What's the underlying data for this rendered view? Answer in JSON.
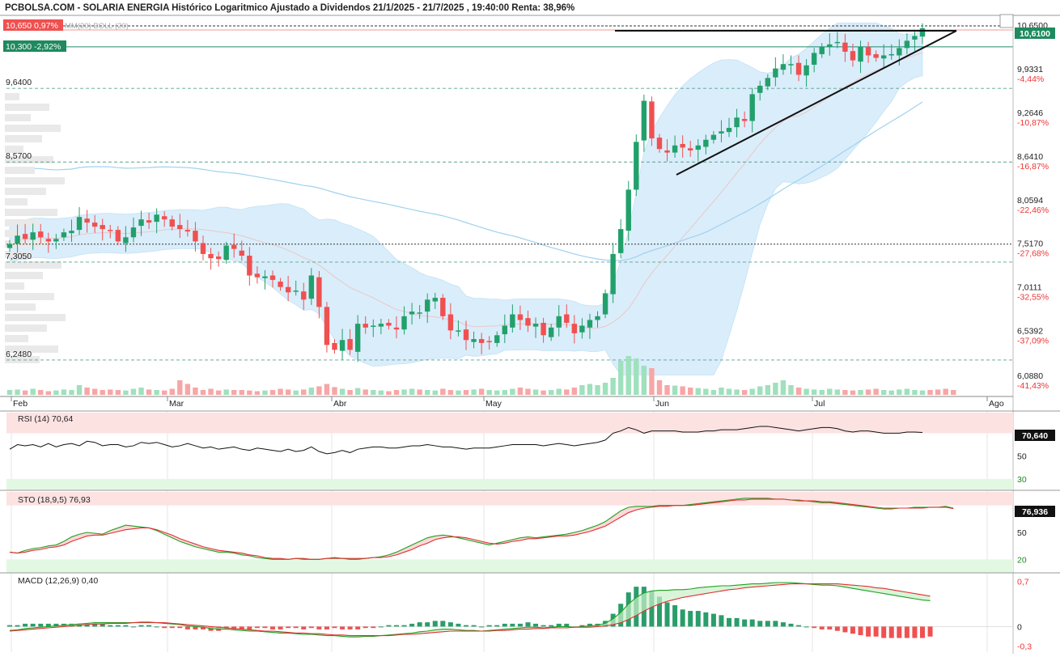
{
  "header": {
    "title": "PCBOLSA.COM - SOLARIA ENERGIA Histórico Logaritmico Ajustado a Dividendos 21/1/2025 - 21/7/2025 , 19:40:00 Renta: 38,96%",
    "boll_label": "MM(20) BOLL (20)"
  },
  "badges": {
    "high_label": "10,650  0,97%",
    "low_label": "10,300  -2,92%",
    "last_price": "10,6100"
  },
  "colors": {
    "up": "#22a06b",
    "down": "#f05050",
    "boll_fill": "#d6ecfb",
    "mm50": "#9fd2f0",
    "rsi_line": "#111111",
    "sto_k": "#22a022",
    "sto_d": "#e03030",
    "macd_line": "#22a022",
    "signal_line": "#e03030",
    "overbought_band": "#fde2e2",
    "oversold_band": "#e3f8e3"
  },
  "chart_data": [
    {
      "type": "candlestick",
      "title": "SOLARIA ENERGIA",
      "scale": "log",
      "x_ticks": [
        "Feb",
        "Mar",
        "Abr",
        "May",
        "Jun",
        "Jul",
        "Ago"
      ],
      "y_ticks": [
        {
          "value": 10.65,
          "label": "10,6500",
          "pct": ""
        },
        {
          "value": 9.9331,
          "label": "9,9331",
          "pct": "-4,44%"
        },
        {
          "value": 9.2646,
          "label": "9,2646",
          "pct": "-10,87%"
        },
        {
          "value": 8.641,
          "label": "8,6410",
          "pct": "-16,87%"
        },
        {
          "value": 8.0594,
          "label": "8,0594",
          "pct": "-22,46%"
        },
        {
          "value": 7.517,
          "label": "7,5170",
          "pct": "-27,68%"
        },
        {
          "value": 7.0111,
          "label": "7,0111",
          "pct": "-32,55%"
        },
        {
          "value": 6.5392,
          "label": "6,5392",
          "pct": "-37,09%"
        },
        {
          "value": 6.088,
          "label": "6,0880",
          "pct": "-41,43%"
        }
      ],
      "levels": [
        {
          "value": 9.64,
          "label": "9,6400"
        },
        {
          "value": 8.57,
          "label": "8,5700"
        },
        {
          "value": 7.305,
          "label": "7,3050"
        },
        {
          "value": 6.248,
          "label": "6,2480"
        },
        {
          "value": 10.3,
          "label": ""
        },
        {
          "value": 10.65,
          "label": ""
        },
        {
          "value": 7.517,
          "label": ""
        }
      ],
      "close": [
        7.52,
        7.62,
        7.58,
        7.66,
        7.6,
        7.55,
        7.58,
        7.66,
        7.68,
        7.85,
        7.78,
        7.73,
        7.7,
        7.68,
        7.55,
        7.6,
        7.72,
        7.82,
        7.78,
        7.88,
        7.82,
        7.73,
        7.7,
        7.67,
        7.55,
        7.4,
        7.35,
        7.34,
        7.5,
        7.46,
        7.38,
        7.15,
        7.13,
        7.14,
        7.1,
        7.02,
        6.96,
        6.98,
        6.88,
        7.15,
        6.8,
        6.4,
        6.35,
        6.45,
        6.35,
        6.62,
        6.58,
        6.6,
        6.62,
        6.6,
        6.56,
        6.7,
        6.75,
        6.74,
        6.88,
        6.9,
        6.7,
        6.55,
        6.55,
        6.45,
        6.46,
        6.42,
        6.43,
        6.5,
        6.6,
        6.72,
        6.66,
        6.6,
        6.62,
        6.5,
        6.58,
        6.7,
        6.63,
        6.52,
        6.6,
        6.66,
        6.7,
        6.95,
        7.4,
        7.7,
        8.2,
        8.85,
        9.45,
        8.9,
        8.75,
        8.7,
        8.8,
        8.77,
        8.73,
        8.8,
        8.88,
        8.95,
        9.0,
        9.05,
        9.2,
        9.15,
        9.55,
        9.68,
        9.8,
        9.95,
        10.02,
        10.02,
        9.85,
        10.0,
        10.2,
        10.3,
        10.34,
        10.38,
        10.22,
        10.08,
        10.3,
        10.16,
        10.12,
        10.16,
        10.18,
        10.28,
        10.4,
        10.48,
        10.61
      ],
      "volume_scale_note": "relative",
      "volume": [
        20,
        22,
        18,
        25,
        20,
        15,
        18,
        22,
        20,
        40,
        30,
        25,
        20,
        22,
        20,
        18,
        25,
        30,
        22,
        20,
        18,
        25,
        60,
        45,
        30,
        20,
        25,
        18,
        22,
        20,
        20,
        18,
        15,
        18,
        20,
        25,
        22,
        18,
        22,
        30,
        35,
        45,
        32,
        25,
        20,
        28,
        22,
        20,
        18,
        15,
        20,
        22,
        25,
        22,
        20,
        18,
        25,
        20,
        18,
        20,
        22,
        25,
        20,
        18,
        20,
        25,
        30,
        25,
        22,
        18,
        20,
        25,
        22,
        30,
        40,
        45,
        40,
        50,
        70,
        140,
        160,
        150,
        120,
        110,
        60,
        40,
        38,
        35,
        30,
        28,
        25,
        20,
        30,
        25,
        22,
        20,
        25,
        35,
        40,
        50,
        60,
        40,
        30,
        25,
        22,
        20,
        25,
        22,
        20,
        18,
        20,
        22,
        25,
        20,
        18,
        22,
        25,
        20,
        18,
        20,
        22,
        25,
        20
      ],
      "volume_up_note": "bars coloured green when close rises, red when it falls"
    },
    {
      "type": "line",
      "title": "RSI (14)",
      "last_value": "70,64",
      "last_badge": "70,640",
      "y_ticks": [
        "50",
        "30"
      ],
      "overbought": 70,
      "oversold": 30,
      "values": [
        56,
        60,
        59,
        60,
        58,
        61,
        58,
        60,
        61,
        59,
        63,
        62,
        59,
        60,
        60,
        58,
        59,
        62,
        61,
        62,
        60,
        58,
        59,
        61,
        59,
        57,
        58,
        56,
        57,
        58,
        56,
        55,
        57,
        56,
        55,
        54,
        56,
        54,
        55,
        58,
        54,
        52,
        53,
        55,
        53,
        56,
        57,
        58,
        58,
        57,
        57,
        58,
        59,
        59,
        60,
        59,
        58,
        58,
        57,
        56,
        57,
        57,
        57,
        58,
        59,
        60,
        60,
        60,
        60,
        59,
        60,
        61,
        60,
        59,
        60,
        61,
        62,
        64,
        70,
        72,
        75,
        73,
        70,
        72,
        72,
        72,
        72,
        71,
        71,
        71,
        72,
        72,
        73,
        73,
        73,
        74,
        75,
        76,
        76,
        75,
        74,
        73,
        72,
        73,
        74,
        75,
        75,
        74,
        72,
        71,
        72,
        72,
        71,
        70,
        70,
        70,
        71,
        71,
        70.64
      ]
    },
    {
      "type": "line",
      "title": "STO (18,9,5)",
      "last_value": "76,93",
      "last_badge": "76,936",
      "y_ticks": [
        "50",
        "20"
      ],
      "overbought": 80,
      "oversold": 20,
      "k": [
        28,
        27,
        30,
        32,
        33,
        35,
        36,
        40,
        45,
        48,
        50,
        49,
        48,
        52,
        55,
        58,
        57,
        56,
        55,
        52,
        48,
        44,
        40,
        37,
        34,
        32,
        30,
        28,
        28,
        27,
        25,
        24,
        22,
        21,
        20,
        20,
        20,
        21,
        20,
        20,
        20,
        21,
        22,
        21,
        20,
        20,
        21,
        22,
        23,
        25,
        28,
        32,
        36,
        40,
        44,
        46,
        47,
        46,
        44,
        42,
        40,
        38,
        36,
        38,
        40,
        42,
        44,
        45,
        44,
        45,
        46,
        47,
        48,
        50,
        52,
        55,
        58,
        62,
        68,
        74,
        78,
        79,
        79,
        79,
        80,
        80,
        80,
        80,
        81,
        82,
        83,
        84,
        85,
        86,
        87,
        88,
        88,
        88,
        88,
        87,
        87,
        86,
        85,
        85,
        84,
        83,
        83,
        82,
        81,
        80,
        79,
        78,
        77,
        76,
        76,
        77,
        77,
        78,
        78,
        78,
        78,
        79,
        76.93
      ],
      "d": [
        28,
        27,
        28,
        30,
        31,
        33,
        34,
        36,
        40,
        43,
        46,
        47,
        47,
        49,
        51,
        53,
        54,
        55,
        55,
        53,
        50,
        47,
        43,
        40,
        37,
        34,
        32,
        30,
        29,
        28,
        27,
        25,
        24,
        22,
        21,
        21,
        20,
        21,
        21,
        20,
        20,
        21,
        21,
        21,
        21,
        21,
        21,
        22,
        22,
        23,
        25,
        28,
        31,
        35,
        38,
        42,
        44,
        45,
        45,
        44,
        42,
        40,
        38,
        37,
        38,
        40,
        41,
        43,
        43,
        44,
        45,
        46,
        46,
        47,
        49,
        51,
        54,
        57,
        62,
        67,
        72,
        75,
        77,
        78,
        79,
        79,
        80,
        80,
        80,
        81,
        82,
        83,
        84,
        85,
        86,
        86,
        87,
        87,
        87,
        87,
        87,
        86,
        86,
        85,
        85,
        84,
        84,
        83,
        82,
        81,
        80,
        79,
        78,
        77,
        77,
        77,
        77,
        77,
        77,
        78,
        78,
        78,
        76.5
      ]
    },
    {
      "type": "line",
      "title": "MACD (12,26,9)",
      "last_value": "0,40",
      "y_ticks": [
        "0,7",
        "0",
        "-0,3"
      ],
      "macd": [
        -0.06,
        -0.05,
        -0.03,
        -0.02,
        -0.01,
        0.0,
        0.01,
        0.02,
        0.03,
        0.04,
        0.05,
        0.06,
        0.06,
        0.06,
        0.06,
        0.06,
        0.06,
        0.07,
        0.07,
        0.06,
        0.05,
        0.04,
        0.03,
        0.01,
        0.0,
        -0.01,
        -0.03,
        -0.04,
        -0.04,
        -0.05,
        -0.06,
        -0.07,
        -0.07,
        -0.08,
        -0.09,
        -0.1,
        -0.1,
        -0.11,
        -0.12,
        -0.12,
        -0.13,
        -0.14,
        -0.14,
        -0.15,
        -0.16,
        -0.16,
        -0.15,
        -0.15,
        -0.14,
        -0.13,
        -0.12,
        -0.11,
        -0.1,
        -0.08,
        -0.07,
        -0.05,
        -0.04,
        -0.04,
        -0.05,
        -0.06,
        -0.06,
        -0.07,
        -0.06,
        -0.05,
        -0.04,
        -0.03,
        -0.02,
        -0.01,
        -0.01,
        -0.02,
        -0.01,
        0.0,
        0.0,
        -0.01,
        0.0,
        0.01,
        0.02,
        0.05,
        0.12,
        0.22,
        0.35,
        0.45,
        0.52,
        0.55,
        0.56,
        0.56,
        0.57,
        0.57,
        0.58,
        0.6,
        0.61,
        0.62,
        0.63,
        0.63,
        0.64,
        0.65,
        0.66,
        0.66,
        0.67,
        0.68,
        0.68,
        0.68,
        0.67,
        0.66,
        0.65,
        0.64,
        0.64,
        0.63,
        0.61,
        0.59,
        0.57,
        0.55,
        0.53,
        0.51,
        0.49,
        0.47,
        0.45,
        0.43,
        0.41,
        0.4
      ],
      "signal": [
        -0.07,
        -0.06,
        -0.05,
        -0.04,
        -0.03,
        -0.02,
        -0.01,
        0.0,
        0.01,
        0.02,
        0.03,
        0.04,
        0.04,
        0.05,
        0.05,
        0.05,
        0.06,
        0.06,
        0.06,
        0.06,
        0.06,
        0.05,
        0.04,
        0.03,
        0.02,
        0.01,
        0.0,
        -0.01,
        -0.02,
        -0.03,
        -0.04,
        -0.05,
        -0.06,
        -0.07,
        -0.07,
        -0.08,
        -0.09,
        -0.1,
        -0.1,
        -0.11,
        -0.11,
        -0.12,
        -0.13,
        -0.13,
        -0.14,
        -0.14,
        -0.14,
        -0.14,
        -0.14,
        -0.14,
        -0.13,
        -0.12,
        -0.12,
        -0.11,
        -0.1,
        -0.09,
        -0.08,
        -0.07,
        -0.07,
        -0.07,
        -0.07,
        -0.07,
        -0.07,
        -0.06,
        -0.06,
        -0.05,
        -0.04,
        -0.04,
        -0.03,
        -0.03,
        -0.02,
        -0.02,
        -0.02,
        -0.01,
        -0.01,
        -0.01,
        0.0,
        0.01,
        0.03,
        0.06,
        0.11,
        0.17,
        0.24,
        0.3,
        0.35,
        0.39,
        0.42,
        0.45,
        0.47,
        0.49,
        0.51,
        0.53,
        0.55,
        0.57,
        0.58,
        0.6,
        0.61,
        0.62,
        0.63,
        0.64,
        0.65,
        0.66,
        0.66,
        0.66,
        0.66,
        0.66,
        0.66,
        0.66,
        0.65,
        0.64,
        0.63,
        0.62,
        0.6,
        0.59,
        0.57,
        0.55,
        0.53,
        0.51,
        0.49,
        0.47
      ]
    }
  ]
}
